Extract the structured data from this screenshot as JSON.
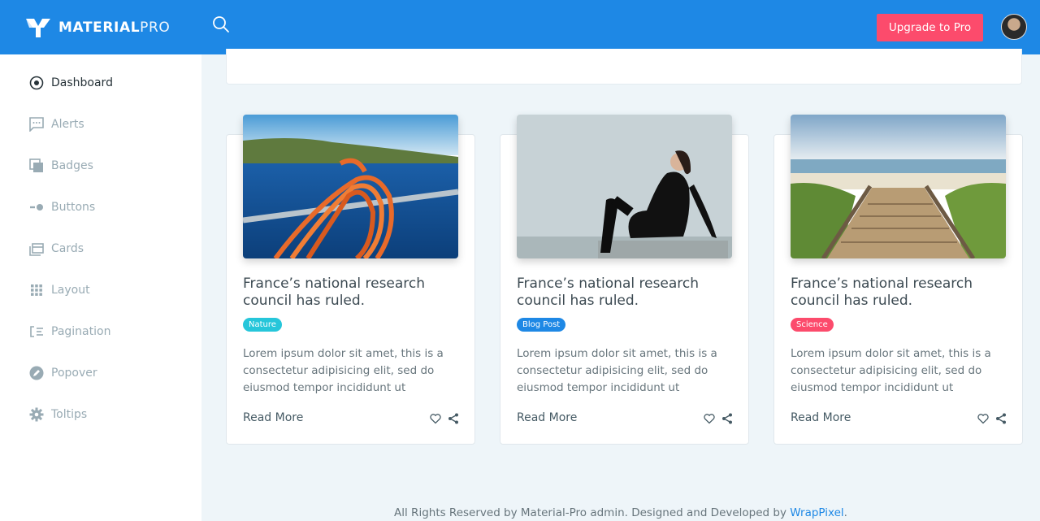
{
  "header": {
    "brand_bold": "MATERIAL",
    "brand_light": "PRO",
    "upgrade_label": "Upgrade to Pro",
    "brand_color": "#1e88e5",
    "upgrade_color": "#fc4b6c"
  },
  "sidebar": {
    "items": [
      {
        "label": "Dashboard",
        "icon": "dashboard-icon",
        "active": true
      },
      {
        "label": "Alerts",
        "icon": "chat-alert-icon"
      },
      {
        "label": "Badges",
        "icon": "badge-icon"
      },
      {
        "label": "Buttons",
        "icon": "toggle-icon"
      },
      {
        "label": "Cards",
        "icon": "card-icon"
      },
      {
        "label": "Layout",
        "icon": "grid-icon"
      },
      {
        "label": "Pagination",
        "icon": "list-icon"
      },
      {
        "label": "Popover",
        "icon": "pen-circle-icon"
      },
      {
        "label": "Toltips",
        "icon": "gear-icon"
      }
    ]
  },
  "cards": [
    {
      "title": "France’s national research council has ruled.",
      "badge": "Nature",
      "badge_color": "#26c6da",
      "text": "Lorem ipsum dolor sit amet, this is a consectetur adipisicing elit, sed do eiusmod tempor incididunt ut",
      "read_more": "Read More"
    },
    {
      "title": "France’s national research council has ruled.",
      "badge": "Blog Post",
      "badge_color": "#1e88e5",
      "text": "Lorem ipsum dolor sit amet, this is a consectetur adipisicing elit, sed do eiusmod tempor incididunt ut",
      "read_more": "Read More"
    },
    {
      "title": "France’s national research council has ruled.",
      "badge": "Science",
      "badge_color": "#fc4b6c",
      "text": "Lorem ipsum dolor sit amet, this is a consectetur adipisicing elit, sed do eiusmod tempor incididunt ut",
      "read_more": "Read More"
    }
  ],
  "footer": {
    "text": "All Rights Reserved by Material-Pro admin. Designed and Developed by ",
    "link": "WrapPixel",
    "end": "."
  }
}
